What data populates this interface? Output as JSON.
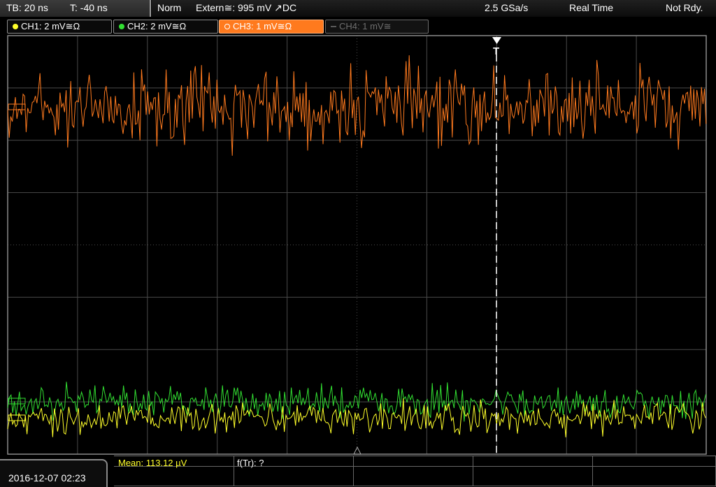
{
  "top_bar": {
    "timebase": "TB: 20 ns",
    "trigger_offset": "T: -40 ns",
    "trigger_mode": "Norm",
    "trigger_source": "Extern≅: 995 mV ↗DC",
    "sample_rate": "2.5 GSa/s",
    "acquisition_mode": "Real Time",
    "trigger_state": "Not Rdy."
  },
  "channels": [
    {
      "label": "CH1: 2 mV≅Ω",
      "color": "#ffff2a",
      "active": false
    },
    {
      "label": "CH2: 2 mV≅Ω",
      "color": "#32e032",
      "active": false
    },
    {
      "label": "CH3: 1 mV≅Ω",
      "color": "#ff7a1e",
      "active": true
    },
    {
      "label": "CH4: 1 mV≅",
      "color": "#6e6e6e",
      "active": false
    }
  ],
  "trigger_marker": "T",
  "measurements": {
    "mean": "Mean: 113.12 µV",
    "freq": "f(Tr): ?"
  },
  "datetime": "2016-12-07 02:23",
  "colors": {
    "grid": "#4a4a4a",
    "grid_border": "#8a8a8a",
    "ch1": "#ffff2a",
    "ch2": "#32e032",
    "ch3": "#ff7a1e",
    "trigger_line": "#ffffff"
  }
}
